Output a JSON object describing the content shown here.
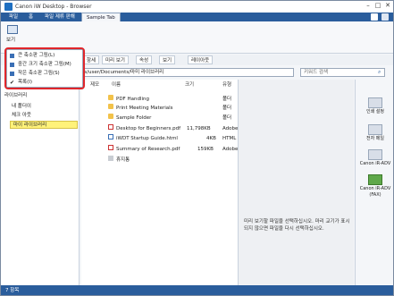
{
  "window": {
    "title": "Canon iW Desktop - Browser"
  },
  "ribbon_tabs": [
    {
      "label": "파일"
    },
    {
      "label": "홈"
    },
    {
      "label": "파일 제류 판해"
    },
    {
      "label": "Sample Tab"
    }
  ],
  "ribbon": {
    "view_label": "보기"
  },
  "view_menu": {
    "items": [
      {
        "label": "큰 축소판 그림(L)"
      },
      {
        "label": "중간 크기 축소판 그림(M)"
      },
      {
        "label": "작은 축소판 그림(S)"
      },
      {
        "label": "목록(I)"
      }
    ]
  },
  "toolbar": {
    "btn1": "항세",
    "btn2": "미리 보기",
    "btn3": "속성",
    "btn4": "보기",
    "btn5": "레이아웃"
  },
  "address": {
    "path": "rs/user/Documents/마미 라이브러리",
    "search_placeholder": "키워드 검색"
  },
  "nav": {
    "header": "라이브러리",
    "items": [
      {
        "label": "내 폴더이"
      },
      {
        "label": "체크 아웃"
      },
      {
        "label": "마이 라이브러리"
      }
    ]
  },
  "filelist": {
    "columns": [
      "제모",
      "이름",
      "크기",
      "유형"
    ],
    "rows": [
      {
        "name": "PDF Handling",
        "size": "",
        "type": "폴더",
        "kind": "folder"
      },
      {
        "name": "Print Meeting Materials",
        "size": "",
        "type": "폴더",
        "kind": "folder"
      },
      {
        "name": "Sample Folder",
        "size": "",
        "type": "폴더",
        "kind": "folder"
      },
      {
        "name": "Desktop for Beginners.pdf",
        "size": "11,798KB",
        "type": "Adobe",
        "kind": "pdf"
      },
      {
        "name": "iWDT Startup Guide.html",
        "size": "4KB",
        "type": "HTML",
        "kind": "html"
      },
      {
        "name": "Summary of Research.pdf",
        "size": "159KB",
        "type": "Adobe",
        "kind": "pdf"
      },
      {
        "name": "휴지통",
        "size": "",
        "type": "",
        "kind": "trash"
      }
    ]
  },
  "preview": {
    "message": "미리 보기할 파일을 선택하십시오. 마리 교기가 표시 되지 않으면 파일을 다시 선택하십시오."
  },
  "right_panel": {
    "items": [
      {
        "label": "인쇄 설정"
      },
      {
        "label": "전자 메일"
      },
      {
        "label": "Canon iR-ADV"
      },
      {
        "label": "Canon iR-ADV (FAX)"
      }
    ]
  },
  "status": {
    "text": "7 항목"
  },
  "colors": {
    "accent": "#2a5d9c",
    "highlight": "#e0262b",
    "selected": "#fff27a"
  }
}
